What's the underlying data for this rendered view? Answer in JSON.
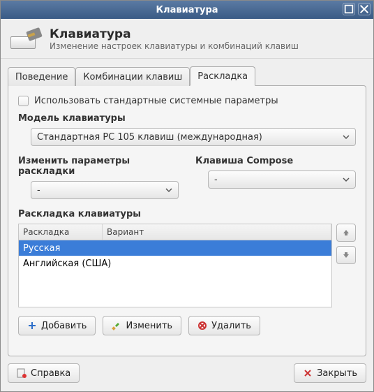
{
  "window": {
    "title": "Клавиатура"
  },
  "header": {
    "title": "Клавиатура",
    "subtitle": "Изменение настроек клавиатуры и комбинаций клавиш"
  },
  "tabs": [
    {
      "label": "Поведение",
      "active": false
    },
    {
      "label": "Комбинации клавиш",
      "active": false
    },
    {
      "label": "Раскладка",
      "active": true
    }
  ],
  "layout_tab": {
    "use_system_defaults": {
      "label": "Использовать стандартные системные параметры",
      "checked": false
    },
    "model": {
      "label": "Модель клавиатуры",
      "value": "Стандартная PC 105 клавиш (международная)"
    },
    "change_options": {
      "label": "Изменить параметры раскладки",
      "value": "-"
    },
    "compose_key": {
      "label": "Клавиша Compose",
      "value": "-"
    },
    "layouts": {
      "label": "Раскладка клавиатуры",
      "columns": [
        "Раскладка",
        "Вариант"
      ],
      "rows": [
        {
          "layout": "Русская",
          "variant": "",
          "selected": true
        },
        {
          "layout": "Английская (США)",
          "variant": "",
          "selected": false
        }
      ]
    },
    "buttons": {
      "add": "Добавить",
      "edit": "Изменить",
      "delete": "Удалить"
    }
  },
  "footer": {
    "help": "Справка",
    "close": "Закрыть"
  }
}
